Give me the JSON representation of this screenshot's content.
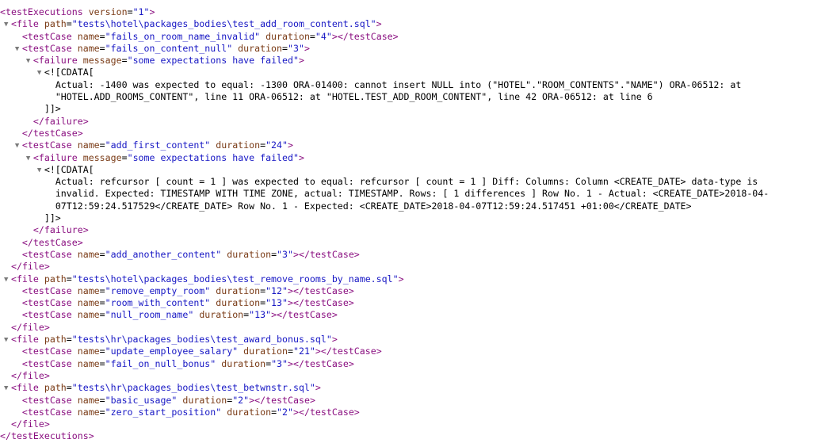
{
  "document": {
    "type": "xml-tree-view",
    "root_tag": "testExecutions",
    "root_attr_name": "version",
    "root_attr_value": "1",
    "colors": {
      "background": "#ffffff",
      "tag": "#8a0f80",
      "attribute_name": "#7a3b16",
      "attribute_value": "#1717c4",
      "text": "#000000",
      "triangle": "#7b7b7b"
    }
  },
  "syntax": {
    "lt": "<",
    "gt": ">",
    "lt_slash": "</",
    "eq_quote": "=\"",
    "quote": "\"",
    "quote_gt": "\">",
    "cdata_open": "<![CDATA[",
    "cdata_close": "]]>",
    "triangle": "▼"
  },
  "labels": {
    "tag_testExecutions": "testExecutions",
    "tag_file": "file",
    "tag_testCase": "testCase",
    "tag_failure": "failure",
    "attr_version": "version",
    "attr_path": "path",
    "attr_name": "name",
    "attr_duration": "duration",
    "attr_message": "message",
    "close_testExecutions": "</testExecutions>",
    "close_file": "</file>",
    "close_testCase": "</testCase>",
    "close_failure": "</failure>"
  },
  "files": [
    {
      "path": "tests\\hotel\\packages_bodies\\test_add_room_content.sql",
      "test_cases": [
        {
          "name": "fails_on_room_name_invalid",
          "duration": "4",
          "has_failure": false
        },
        {
          "name": "fails_on_content_null",
          "duration": "3",
          "has_failure": true,
          "failure_message": "some expectations have failed",
          "cdata_lines": [
            "Actual: -1400 was expected to equal: -1300 ORA-01400: cannot insert NULL into (\"HOTEL\".\"ROOM_CONTENTS\".\"NAME\") ORA-06512: at",
            "\"HOTEL.ADD_ROOMS_CONTENT\", line 11 ORA-06512: at \"HOTEL.TEST_ADD_ROOM_CONTENT\", line 42 ORA-06512: at line 6"
          ]
        },
        {
          "name": "add_first_content",
          "duration": "24",
          "has_failure": true,
          "failure_message": "some expectations have failed",
          "cdata_lines": [
            "Actual: refcursor [ count = 1 ] was expected to equal: refcursor [ count = 1 ] Diff: Columns: Column <CREATE_DATE> data-type is",
            "invalid. Expected: TIMESTAMP WITH TIME ZONE, actual: TIMESTAMP. Rows: [ 1 differences ] Row No. 1 - Actual: <CREATE_DATE>2018-04-",
            "07T12:59:24.517529</CREATE_DATE> Row No. 1 - Expected: <CREATE_DATE>2018-04-07T12:59:24.517451 +01:00</CREATE_DATE>"
          ]
        },
        {
          "name": "add_another_content",
          "duration": "3",
          "has_failure": false
        }
      ]
    },
    {
      "path": "tests\\hotel\\packages_bodies\\test_remove_rooms_by_name.sql",
      "test_cases": [
        {
          "name": "remove_empty_room",
          "duration": "12",
          "has_failure": false
        },
        {
          "name": "room_with_content",
          "duration": "13",
          "has_failure": false
        },
        {
          "name": "null_room_name",
          "duration": "13",
          "has_failure": false
        }
      ]
    },
    {
      "path": "tests\\hr\\packages_bodies\\test_award_bonus.sql",
      "test_cases": [
        {
          "name": "update_employee_salary",
          "duration": "21",
          "has_failure": false
        },
        {
          "name": "fail_on_null_bonus",
          "duration": "3",
          "has_failure": false
        }
      ]
    },
    {
      "path": "tests\\hr\\packages_bodies\\test_betwnstr.sql",
      "test_cases": [
        {
          "name": "basic_usage",
          "duration": "2",
          "has_failure": false
        },
        {
          "name": "zero_start_position",
          "duration": "2",
          "has_failure": false
        }
      ]
    }
  ]
}
